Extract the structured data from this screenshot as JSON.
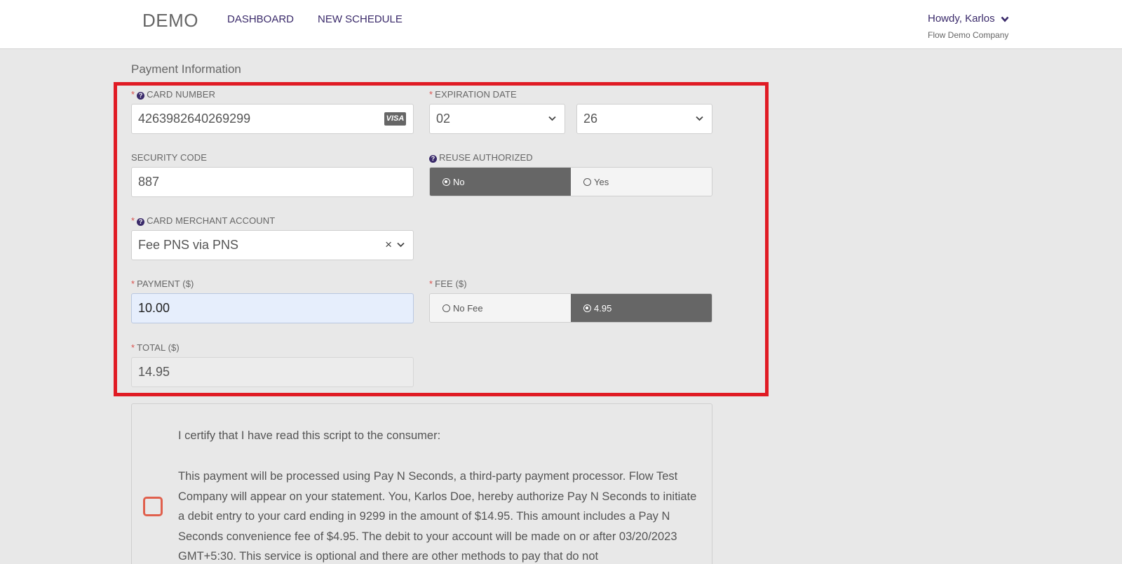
{
  "header": {
    "brand": "DEMO",
    "nav": {
      "dashboard": "DASHBOARD",
      "new_schedule": "NEW SCHEDULE"
    },
    "user_greeting": "Howdy, Karlos",
    "company": "Flow Demo Company"
  },
  "section_title": "Payment Information",
  "form": {
    "card_number": {
      "required": "*",
      "label": "CARD NUMBER",
      "value": "4263982640269299",
      "brand": "VISA"
    },
    "expiration": {
      "required": "*",
      "label": "EXPIRATION DATE",
      "month": "02",
      "year": "26"
    },
    "security_code": {
      "label": "SECURITY CODE",
      "value": "887"
    },
    "reuse_authorized": {
      "label": "REUSE AUTHORIZED",
      "options": [
        "No",
        "Yes"
      ],
      "selected": "No"
    },
    "merchant_account": {
      "required": "*",
      "label": "CARD MERCHANT ACCOUNT",
      "value": "Fee PNS via PNS",
      "clear": "×"
    },
    "payment": {
      "required": "*",
      "label": "PAYMENT ($)",
      "value": "10.00"
    },
    "fee": {
      "required": "*",
      "label": "FEE ($)",
      "options": [
        "No Fee",
        "4.95"
      ],
      "selected": "4.95"
    },
    "total": {
      "required": "*",
      "label": "TOTAL ($)",
      "value": "14.95"
    }
  },
  "certification": {
    "heading": "I certify that I have read this script to the consumer:",
    "body": "This payment will be processed using Pay N Seconds, a third-party payment processor. Flow Test Company will appear on your statement. You, Karlos Doe, hereby authorize Pay N Seconds to initiate a debit entry to your card ending in 9299 in the amount of $14.95. This amount includes a Pay N Seconds convenience fee of $4.95. The debit to your account will be made on or after 03/20/2023 GMT+5:30. This service is optional and there are other methods to pay that do not"
  },
  "colors": {
    "accent": "#3a2a6a",
    "highlight_border": "#e01b24",
    "required": "#d9534f",
    "toggle_active": "#666666",
    "checkbox": "#e0604d"
  }
}
